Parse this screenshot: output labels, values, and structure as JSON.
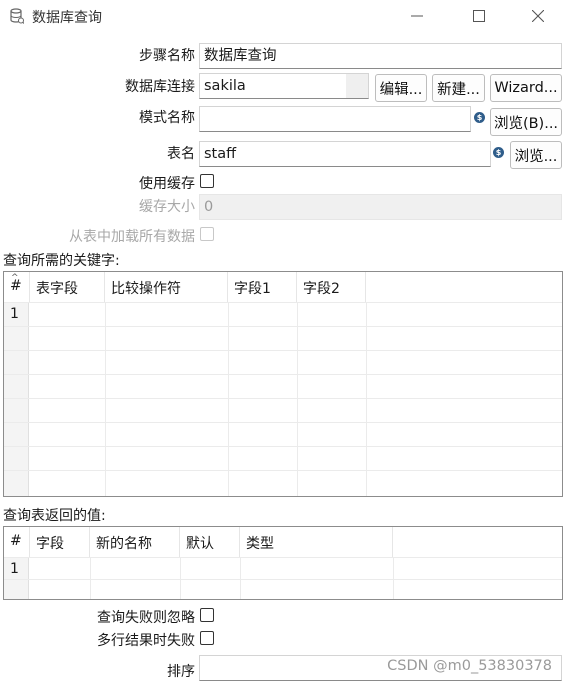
{
  "window": {
    "title": "数据库查询",
    "minimize_glyph": "—",
    "maximize_glyph": "☐",
    "close_glyph": "✕"
  },
  "form": {
    "step_name_label": "步骤名称",
    "step_name_value": "数据库查询",
    "connection_label": "数据库连接",
    "connection_value": "sakila",
    "edit_button": "编辑...",
    "new_button": "新建...",
    "wizard_button": "Wizard...",
    "schema_label": "模式名称",
    "schema_value": "",
    "browse_schema_button": "浏览(B)...",
    "table_label": "表名",
    "table_value": "staff",
    "browse_table_button": "浏览...",
    "use_cache_label": "使用缓存",
    "use_cache_checked": false,
    "cache_size_label": "缓存大小",
    "cache_size_value": "0",
    "load_all_label": "从表中加载所有数据",
    "load_all_checked": false
  },
  "keys_section": {
    "title": "查询所需的关键字:",
    "columns": [
      "#",
      "表字段",
      "比较操作符",
      "字段1",
      "字段2"
    ],
    "rows": [
      {
        "num": "1",
        "cells": [
          "",
          "",
          "",
          ""
        ]
      }
    ]
  },
  "returns_section": {
    "title": "查询表返回的值:",
    "columns": [
      "#",
      "字段",
      "新的名称",
      "默认",
      "类型"
    ],
    "rows": [
      {
        "num": "1",
        "cells": [
          "",
          "",
          "",
          ""
        ]
      }
    ]
  },
  "options": {
    "fail_ignore_label": "查询失败则忽略",
    "fail_ignore_checked": false,
    "multi_fail_label": "多行结果时失败",
    "multi_fail_checked": false,
    "order_label": "排序",
    "order_value": ""
  },
  "watermark": "CSDN @m0_53830378",
  "icons": {
    "app": "database-icon",
    "variable": "variable-dollar-icon"
  },
  "colors": {
    "variable_icon": "#2f5d8a",
    "disabled_text": "#a8a8a8"
  }
}
